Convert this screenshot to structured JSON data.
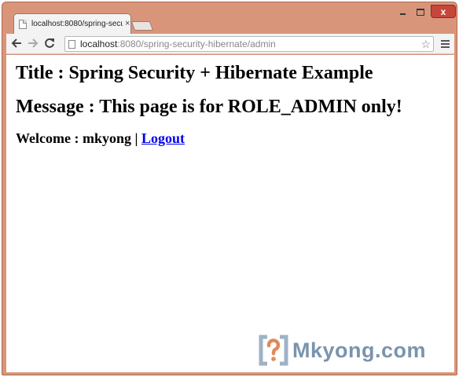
{
  "browser": {
    "tab": {
      "title": "localhost:8080/spring-secu",
      "close": "×"
    },
    "window_controls": {
      "close": "x"
    },
    "address": {
      "host": "localhost",
      "rest": ":8080/spring-security-hibernate/admin"
    },
    "icons": {
      "back": "back-arrow-icon",
      "forward": "forward-arrow-icon",
      "reload": "reload-icon",
      "star": "star-icon",
      "menu": "hamburger-menu-icon",
      "page": "page-icon"
    },
    "frame_color": "#d9957a",
    "close_color": "#c7463a"
  },
  "page": {
    "title_line": "Title : Spring Security + Hibernate Example",
    "message_line": "Message : This page is for ROLE_ADMIN only!",
    "welcome_prefix": "Welcome : mkyong | ",
    "logout_link": "Logout",
    "link_color": "#0000ee"
  },
  "watermark": {
    "text": "Mkyong.com",
    "logo_glyph": "?",
    "color": "#7a94ae"
  }
}
